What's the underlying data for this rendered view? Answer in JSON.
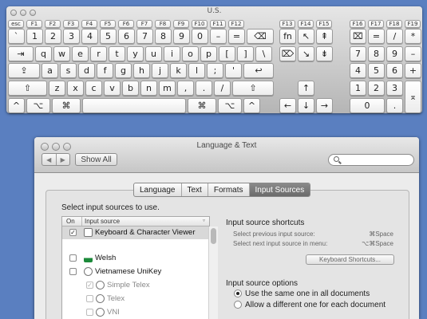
{
  "keyboard": {
    "title": "U.S.",
    "function_row": [
      "esc",
      "F1",
      "F2",
      "F3",
      "F4",
      "F5",
      "F6",
      "F7",
      "F8",
      "F9",
      "F10",
      "F11",
      "F12",
      "F13",
      "F14",
      "F15",
      "F16",
      "F17",
      "F18",
      "F19"
    ],
    "number_row": [
      "`",
      "1",
      "2",
      "3",
      "4",
      "5",
      "6",
      "7",
      "8",
      "9",
      "0",
      "–",
      "=",
      "⌫"
    ],
    "qwerty_row": [
      "⇥",
      "q",
      "w",
      "e",
      "r",
      "t",
      "y",
      "u",
      "i",
      "o",
      "p",
      "[",
      "]",
      "\\"
    ],
    "home_row": [
      "⇪",
      "a",
      "s",
      "d",
      "f",
      "g",
      "h",
      "j",
      "k",
      "l",
      ";",
      "'",
      "↩"
    ],
    "shift_row": [
      "⇧",
      "z",
      "x",
      "c",
      "v",
      "b",
      "n",
      "m",
      ",",
      ".",
      "/",
      "⇧"
    ],
    "bottom_row": [
      "^",
      "⌥",
      "⌘",
      "",
      "⌘",
      "⌥",
      "^"
    ],
    "nav_cluster": [
      "fn",
      "↖",
      "⇞",
      "⌦",
      "↘",
      "⇟",
      "↑",
      "←",
      "↓",
      "→"
    ],
    "numpad": [
      "⌧",
      "=",
      "/",
      "*",
      "7",
      "8",
      "9",
      "–",
      "4",
      "5",
      "6",
      "+",
      "1",
      "2",
      "3",
      "0",
      ".",
      "⌅"
    ]
  },
  "window": {
    "title": "Language & Text",
    "nav_back": "◀",
    "nav_forward": "▶",
    "show_all": "Show All",
    "search_placeholder": "",
    "tabs": [
      "Language",
      "Text",
      "Formats",
      "Input Sources"
    ],
    "active_tab": "Input Sources",
    "instruction": "Select input sources to use.",
    "list_header_on": "On",
    "list_header_source": "Input source",
    "sources": [
      {
        "label": "Keyboard & Character Viewer",
        "checked": true,
        "icon": "keyboard-viewer-icon",
        "selected": true
      },
      {
        "label": "Welsh",
        "checked": false,
        "icon": "welsh-flag-icon"
      },
      {
        "label": "Vietnamese UniKey",
        "checked": false,
        "icon": "unikey-icon"
      },
      {
        "label": "Simple Telex",
        "checked": true,
        "icon": "unikey-icon",
        "sub": true
      },
      {
        "label": "Telex",
        "checked": false,
        "icon": "unikey-icon",
        "sub": true
      },
      {
        "label": "VNI",
        "checked": false,
        "icon": "unikey-icon",
        "sub": true
      }
    ],
    "shortcuts_title": "Input source shortcuts",
    "shortcuts": [
      {
        "label": "Select previous input source:",
        "keys": "⌘Space"
      },
      {
        "label": "Select next input source in menu:",
        "keys": "⌥⌘Space"
      }
    ],
    "keyboard_shortcuts_button": "Keyboard Shortcuts...",
    "options_title": "Input source options",
    "options": [
      {
        "label": "Use the same one in all documents",
        "selected": true
      },
      {
        "label": "Allow a different one for each document",
        "selected": false
      }
    ]
  },
  "colors": {
    "desktop": "#5a7fc0",
    "tab_active": "#777777"
  }
}
